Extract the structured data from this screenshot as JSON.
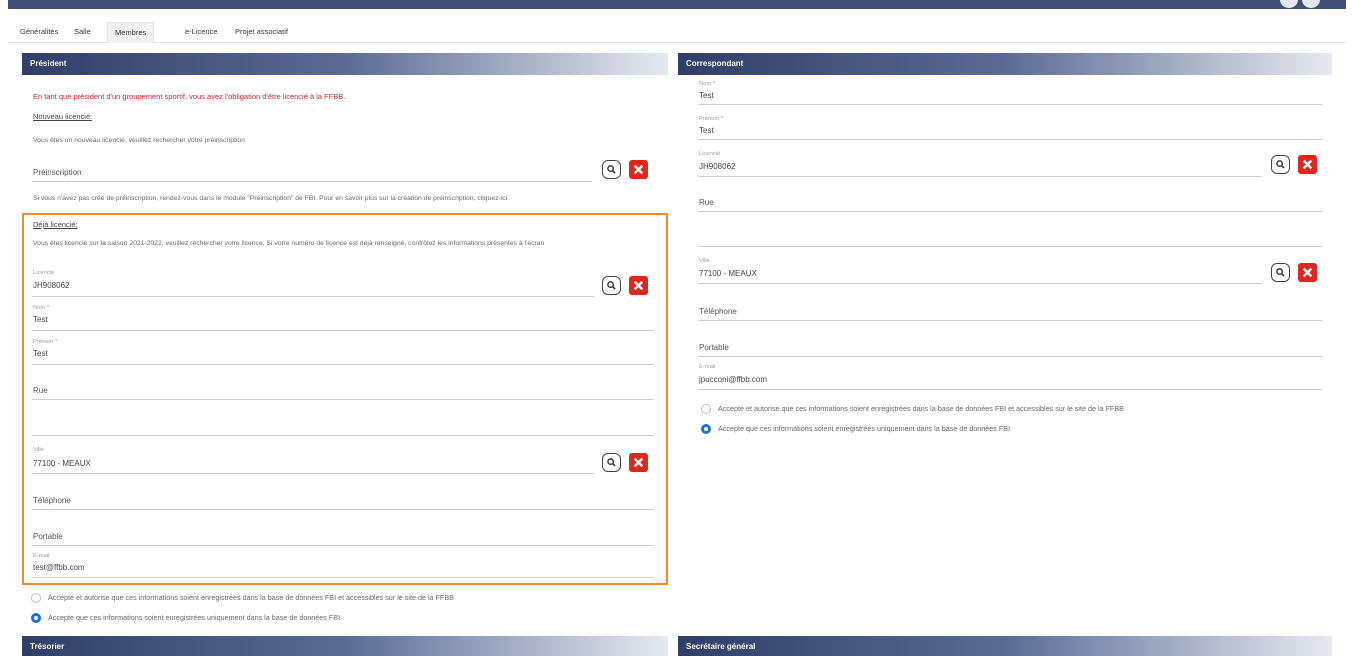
{
  "tabs": [
    "Généralités",
    "Salle",
    "Membres",
    "e-Licence",
    "Projet associatif"
  ],
  "president": {
    "title": "Président",
    "warning": "En tant que président d'un groupement sportif, vous avez l'obligation d'être licencié à la FFBB.",
    "nouveau_heading": "Nouveau licencié:",
    "nouveau_text": "Vous êtes un nouveau licencié, veuillez rechercher votre préinscription",
    "preinscription_placeholder": "Préinscription",
    "preinscription_help": "Si vous n'avez pas créé de préinscription, rendez-vous dans le module \"Préinscription\" de FBI. Pour en savoir plus sur la création de préinscription, cliquez-ici.",
    "deja_heading": "Déjà licencié:",
    "deja_text": "Vous êtes licencié sur la saison 2021-2022, veuillez rechercher votre licence. Si votre numéro de licence est déjà renseigné, contrôlez les informations présentes à l'écran",
    "licencie_label": "Licencié",
    "licencie_value": "JH908062",
    "nom_label": "Nom *",
    "nom_value": "Test",
    "prenom_label": "Prénom *",
    "prenom_value": "Test",
    "rue_placeholder": "Rue",
    "ville_label": "Ville",
    "ville_value": "77100 - MEAUX",
    "telephone_placeholder": "Téléphone",
    "portable_placeholder": "Portable",
    "email_label": "E-mail",
    "email_value": "test@ffbb.com",
    "consent_public": "Accepte et autorise que ces informations soient enregistrées dans la base de données FBI et accessibles sur le site de la FFBB",
    "consent_private": "Accepte que ces informations soient enregistrées uniquement dans la base de données FBI"
  },
  "correspondant": {
    "title": "Correspondant",
    "nom_label": "Nom *",
    "nom_value": "Test",
    "prenom_label": "Prénom *",
    "prenom_value": "Test",
    "licencie_label": "Licencié",
    "licencie_value": "JH908062",
    "rue_placeholder": "Rue",
    "ville_label": "Ville",
    "ville_value": "77100 - MEAUX",
    "telephone_placeholder": "Téléphone",
    "portable_placeholder": "Portable",
    "email_label": "E-mail",
    "email_value": "jpucconi@ffbb.com",
    "consent_public": "Accepte et autorise que ces informations soient enregistrées dans la base de données FBI et accessibles sur le site de la FFBB",
    "consent_private": "Accepte que ces informations soient enregistrées uniquement dans la base de données FBI"
  },
  "tresorier": {
    "title": "Trésorier"
  },
  "secretaire": {
    "title": "Secrétaire général"
  },
  "colors": {
    "header_dark": "#2f3f68",
    "accent_red": "#e2261e",
    "highlight_orange": "#f08c2c",
    "radio_blue": "#1e6fd9"
  },
  "icons": {
    "search": "search-icon",
    "delete": "close-icon"
  }
}
